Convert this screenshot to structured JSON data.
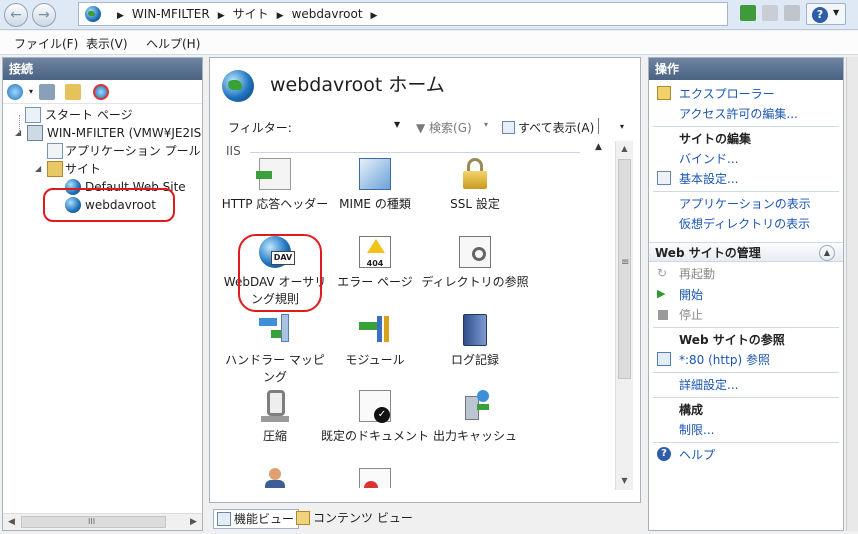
{
  "address_bar": {
    "crumbs": [
      "WIN-MFILTER",
      "サイト",
      "webdavroot"
    ]
  },
  "menu": [
    "ファイル(F)",
    "表示(V)",
    "ヘルプ(H)"
  ],
  "connections": {
    "title": "接続",
    "tree": [
      {
        "label": "スタート ページ"
      },
      {
        "label": "WIN-MFILTER (VMW¥JE2IS"
      },
      {
        "label": "アプリケーション プール"
      },
      {
        "label": "サイト"
      },
      {
        "label": "Default Web Site"
      },
      {
        "label": "webdavroot"
      }
    ],
    "hscroll_grip": "III"
  },
  "center": {
    "title": "webdavroot ホーム",
    "filter_label": "フィルター:",
    "search_label": "検索(G)",
    "show_all_label": "すべて表示(A)",
    "group_label": "IIS",
    "features": [
      {
        "label": "HTTP 応答ヘッダー",
        "icon": "http-response-headers-icon"
      },
      {
        "label": "MIME の種類",
        "icon": "mime-types-icon"
      },
      {
        "label": "SSL 設定",
        "icon": "ssl-lock-icon"
      },
      {
        "label": "WebDAV オーサリング規則",
        "icon": "webdav-icon"
      },
      {
        "label": "エラー ページ",
        "icon": "error-page-icon"
      },
      {
        "label": "ディレクトリの参照",
        "icon": "directory-browsing-icon"
      },
      {
        "label": "ハンドラー マッピング",
        "icon": "handler-mappings-icon"
      },
      {
        "label": "モジュール",
        "icon": "modules-icon"
      },
      {
        "label": "ログ記録",
        "icon": "logging-icon"
      },
      {
        "label": "圧縮",
        "icon": "compression-icon"
      },
      {
        "label": "既定のドキュメント",
        "icon": "default-document-icon"
      },
      {
        "label": "出力キャッシュ",
        "icon": "output-caching-icon"
      },
      {
        "label": "",
        "icon": "authentication-icon"
      },
      {
        "label": "",
        "icon": "authorization-rules-icon"
      }
    ],
    "error_page_code": "404",
    "webdav_badge": "DAV",
    "view_tabs": [
      "機能ビュー",
      "コンテンツ ビュー"
    ]
  },
  "actions": {
    "title": "操作",
    "explore": "エクスプローラー",
    "edit_permissions": "アクセス許可の編集...",
    "site_edit_heading": "サイトの編集",
    "bindings": "バインド...",
    "basic_settings": "基本設定...",
    "view_applications": "アプリケーションの表示",
    "view_virtual_dirs": "仮想ディレクトリの表示",
    "manage_heading": "Web サイトの管理",
    "restart": "再起動",
    "start": "開始",
    "stop": "停止",
    "browse_heading": "Web サイトの参照",
    "browse_link": "*:80 (http) 参照",
    "advanced_settings": "詳細設定...",
    "config_heading": "構成",
    "limits": "制限...",
    "help": "ヘルプ"
  },
  "colors": {
    "accent_link": "#1a56b3",
    "panel_header": "#5a7191",
    "highlight_oval": "#e01a1a"
  }
}
